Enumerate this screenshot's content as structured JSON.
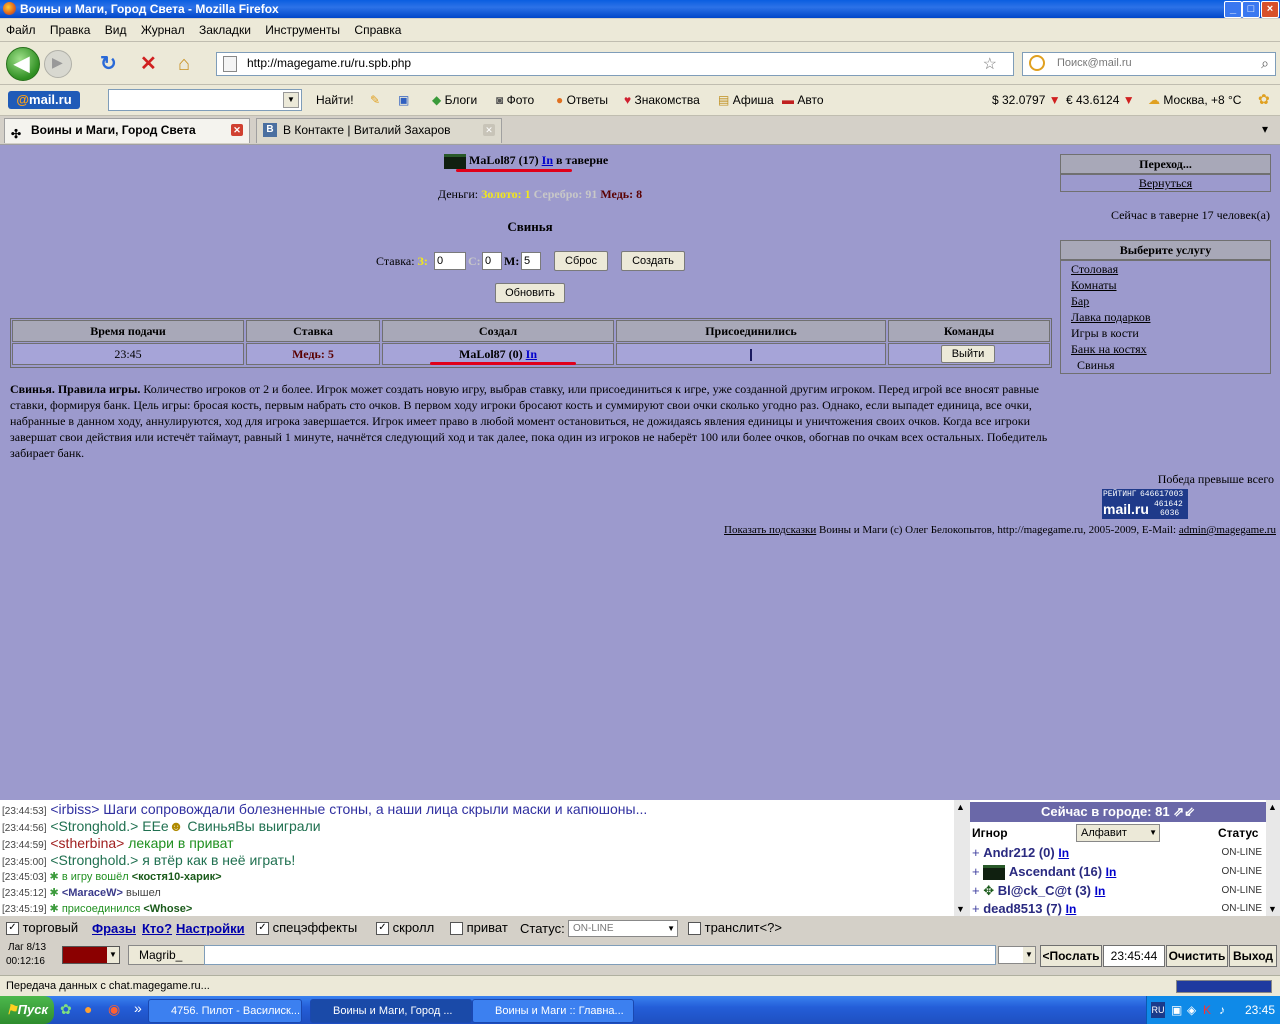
{
  "window": {
    "title": "Воины и Маги, Город Света - Mozilla Firefox",
    "btn_min": "_",
    "btn_max": "□",
    "btn_close": "×"
  },
  "menu": {
    "file": "Файл",
    "edit": "Правка",
    "view": "Вид",
    "history": "Журнал",
    "bookmarks": "Закладки",
    "tools": "Инструменты",
    "help": "Справка"
  },
  "nav": {
    "url": "http://magegame.ru/ru.spb.php",
    "search_placeholder": "Поиск@mail.ru",
    "reload_glyph": "↻",
    "stop_glyph": "✕",
    "home_glyph": "⌂",
    "star_glyph": "☆"
  },
  "mailru": {
    "logo_at": "@",
    "logo_text": "mail.ru",
    "find": "Найти!",
    "blogs": "Блоги",
    "photo": "Фото",
    "answers": "Ответы",
    "dating": "Знакомства",
    "poster": "Афиша",
    "auto": "Авто",
    "usd": "$ 32.0797",
    "eur": "€ 43.6124",
    "weather": "Москва, +8 °C"
  },
  "tabs": [
    {
      "label": "Воины и Маги, Город Света",
      "active": true
    },
    {
      "label": "В Контакте | Виталий Захаров",
      "active": false
    }
  ],
  "page": {
    "player_name": "MaLol87 (17)",
    "in_link": "In",
    "player_location": " в таверне",
    "money_label": "Деньги: ",
    "gold": "Золото: 1",
    "silver": "Серебро: 91",
    "copper": "Медь: 8",
    "game_title": "Свинья",
    "bet_label": "Ставка: ",
    "bet_z_label": "З:",
    "bet_s_label": "С:",
    "bet_m_label": "М:",
    "bet_z": "0",
    "bet_s": "0",
    "bet_m": "5",
    "reset_btn": "Сброс",
    "create_btn": "Создать",
    "refresh_btn": "Обновить",
    "table": {
      "headers": [
        "Время подачи",
        "Ставка",
        "Создал",
        "Присоединились",
        "Команды"
      ],
      "row": {
        "time": "23:45",
        "stake": "Медь: 5",
        "creator": "MaLol87 (0)",
        "creator_in": "In",
        "joined": "",
        "command": "Выйти"
      }
    },
    "rules_title": "Свинья. Правила игры.",
    "rules_text": " Количество игроков от 2 и более. Игрок может создать новую игру, выбрав ставку, или присоединиться к игре, уже созданной другим игроком. Перед игрой все вносят равные ставки, формируя банк. Цель игры: бросая кость, первым набрать сто очков. В первом ходу игроки бросают кость и суммируют свои очки сколько угодно раз. Однако, если выпадет единица, все очки, набранные в данном ходу, аннулируются, ход для игрока завершается. Игрок имеет право в любой момент остановиться, не дожидаясь явления единицы и уничтожения своих очков. Когда все игроки завершат свои действия или истечёт таймаут, равный 1 минуте, начнётся следующий ход и так далее, пока один из игроков не наберёт 100 или более очков, обогнав по очкам всех остальных. Победитель забирает банк.",
    "victory_text": "Победа превыше всего",
    "counter": {
      "label": "РЕЙТИНГ",
      "n1": "646617003",
      "n2": "461642",
      "n3": "6036",
      "brand": "mail.ru"
    },
    "footer_hints": "Показать подсказки",
    "footer_text": " Воины и Маги (c) Олег Белокопытов, http://magegame.ru, 2005-2009, E-Mail: ",
    "footer_email": "admin@magegame.ru"
  },
  "sidebar": {
    "goto_head": "Переход...",
    "back_link": "Вернуться",
    "tavern_count": "Сейчас в таверне 17 человек(а)",
    "service_head": "Выберите услугу",
    "services": [
      "Столовая",
      "Комнаты",
      "Бар",
      "Лавка подарков"
    ],
    "dice_label": "Игры в кости",
    "dice_items": [
      "Банк на костях",
      "Свинья"
    ]
  },
  "chat": {
    "lines": [
      {
        "ts": "[23:44:53]",
        "nick": "<irbiss>",
        "nick_color": "#3030a0",
        "text": " Шаги сопровождали болезненные стоны, а наши лица скрыли маски и капюшоны...",
        "text_color": "#3030a0"
      },
      {
        "ts": "[23:44:56]",
        "nick": "<Stronghold.>",
        "nick_color": "#207050",
        "text": " ЕЕе",
        "text_color": "#207050",
        "after": " СвиньяВы выиграли"
      },
      {
        "ts": "[23:44:59]",
        "nick": "<stherbina>",
        "nick_color": "#a02020",
        "text": " лекари в приват",
        "text_color": "#209020"
      },
      {
        "ts": "[23:45:00]",
        "nick": "<Stronghold.>",
        "nick_color": "#207050",
        "text": " я втёр как в неё играть!",
        "text_color": "#207050"
      }
    ],
    "sys_lines": [
      {
        "ts": "[23:45:03]",
        "text": " в игру вошёл ",
        "who": "<костя10-харик>"
      },
      {
        "ts": "[23:45:12]",
        "text": " ",
        "who": "<MaraceW>",
        "after": " вышел"
      },
      {
        "ts": "[23:45:19]",
        "text": " присоединился ",
        "who": "<Whose>"
      }
    ],
    "smiley_glyph": "☻"
  },
  "city": {
    "head": "Сейчас в городе: 81",
    "col_ignore": "Игнор",
    "sort": "Алфавит",
    "col_status": "Статус",
    "players": [
      {
        "name": "Andr212 (0)",
        "in": "In",
        "status": "ON-LINE"
      },
      {
        "name": "Ascendant (16)",
        "in": "In",
        "status": "ON-LINE"
      },
      {
        "name": "Bl@ck_C@t (3)",
        "in": "In",
        "status": "ON-LINE"
      },
      {
        "name": "dead8513 (7)",
        "in": "In",
        "status": "ON-LINE"
      }
    ]
  },
  "chatopts": {
    "trade": "торговый",
    "phrases": "Фразы",
    "who": "Кто?",
    "settings": "Настройки",
    "effects": "спецэффекты",
    "scroll": "скролл",
    "private": "приват",
    "status_label": "Статус:",
    "status_value": "ON-LINE",
    "translit": "транслит<?>",
    "translit_q": "?"
  },
  "chatinput": {
    "lag": "Лаг 8/13",
    "time": "00:12:16",
    "name": "Magrib_",
    "send": "<Послать",
    "clock": "23:45:44",
    "clear": "Очистить",
    "exit": "Выход"
  },
  "statusbar": {
    "text": "Передача данных с chat.magegame.ru..."
  },
  "taskbar": {
    "start": "Пуск",
    "tasks": [
      "4756. Пилот - Василиск...",
      "Воины и Маги, Город ...",
      "Воины и Маги :: Главна..."
    ],
    "lang": "RU",
    "clock": "23:45"
  }
}
